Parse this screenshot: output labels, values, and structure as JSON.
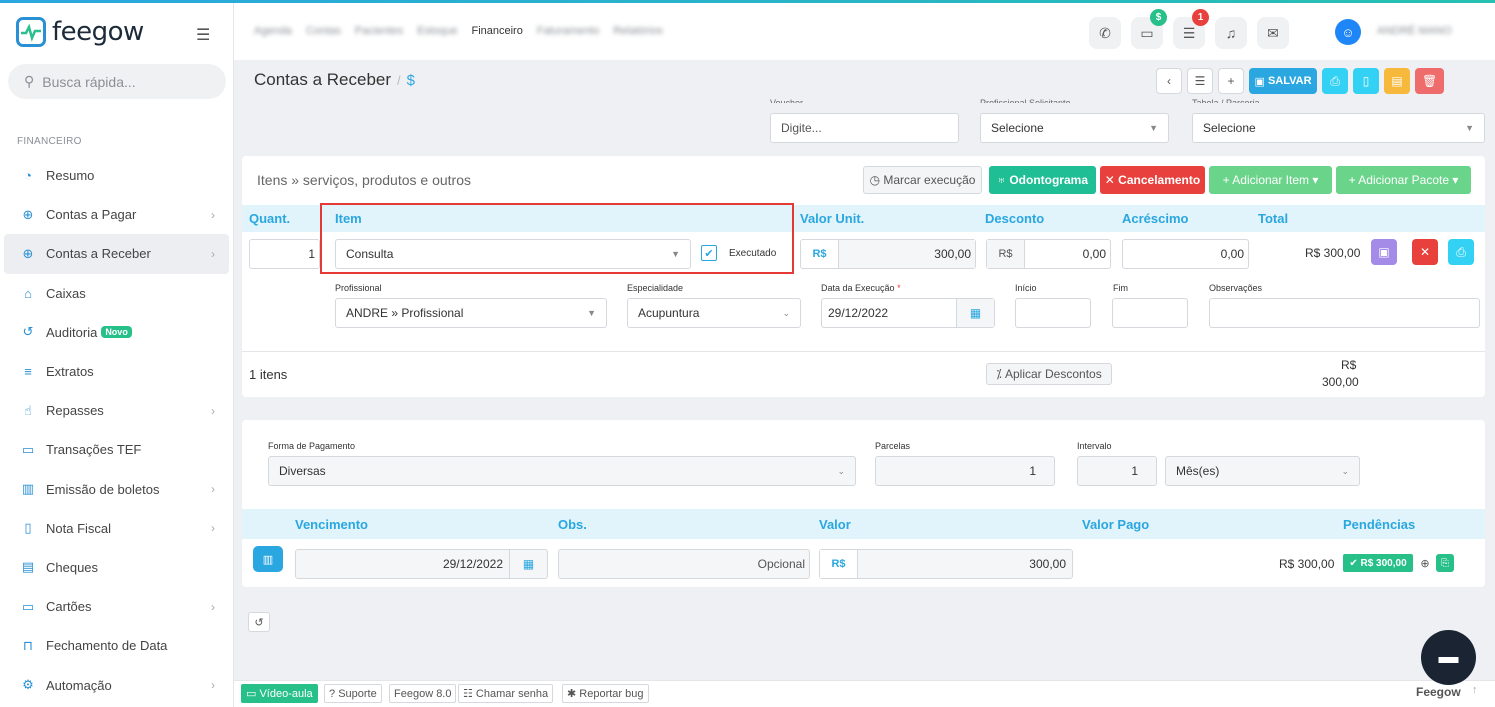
{
  "sidebar": {
    "logo": "feegow",
    "search_placeholder": "Busca rápida...",
    "section": "FINANCEIRO",
    "items": [
      {
        "label": "Resumo",
        "icon": "pie-chart-icon",
        "chev": false
      },
      {
        "label": "Contas a Pagar",
        "icon": "arrow-up-circle-icon",
        "chev": true
      },
      {
        "label": "Contas a Receber",
        "icon": "arrow-down-circle-icon",
        "chev": true,
        "active": true
      },
      {
        "label": "Caixas",
        "icon": "inbox-icon",
        "chev": false
      },
      {
        "label": "Auditoria",
        "icon": "history-icon",
        "chev": false,
        "badge": "Novo"
      },
      {
        "label": "Extratos",
        "icon": "list-icon",
        "chev": false
      },
      {
        "label": "Repasses",
        "icon": "hand-icon",
        "chev": true
      },
      {
        "label": "Transações TEF",
        "icon": "card-icon",
        "chev": false
      },
      {
        "label": "Emissão de boletos",
        "icon": "barcode-icon",
        "chev": true
      },
      {
        "label": "Nota Fiscal",
        "icon": "document-icon",
        "chev": true
      },
      {
        "label": "Cheques",
        "icon": "check-doc-icon",
        "chev": false
      },
      {
        "label": "Cartões",
        "icon": "credit-card-icon",
        "chev": true
      },
      {
        "label": "Fechamento de Data",
        "icon": "lock-icon",
        "chev": false
      },
      {
        "label": "Automação",
        "icon": "gears-icon",
        "chev": true
      }
    ]
  },
  "topnav": {
    "links": [
      "Agenda",
      "Contas",
      "Pacientes",
      "Estoque",
      "Financeiro",
      "Faturamento",
      "Relatórios"
    ],
    "active": "Financeiro",
    "badges": {
      "money": "$",
      "tasks": "1"
    },
    "user": "ANDRÉ MANO"
  },
  "header": {
    "title": "Contas a Receber",
    "sep": "/",
    "current": "$",
    "save": "SALVAR"
  },
  "top_fields": {
    "voucher_label": "Voucher",
    "voucher_placeholder": "Digite...",
    "solicitante_label": "Profissional Solicitante",
    "solicitante_value": "Selecione",
    "tabela_label": "Tabela / Parceria",
    "tabela_value": "Selecione"
  },
  "items": {
    "title": "Itens » serviços, produtos e outros",
    "buttons": {
      "marcar": "Marcar execução",
      "odonto": "Odontograma",
      "cancel": "Cancelamento",
      "add_item": "+ Adicionar Item",
      "add_pacote": "+ Adicionar Pacote"
    },
    "headers": {
      "quant": "Quant.",
      "item": "Item",
      "valor": "Valor Unit.",
      "desconto": "Desconto",
      "acrescimo": "Acréscimo",
      "total": "Total"
    },
    "row": {
      "quant": "1",
      "item": "Consulta",
      "executado": "Executado",
      "currency": "R$",
      "valor": "300,00",
      "desconto": "0,00",
      "acrescimo": "0,00",
      "total": "R$ 300,00"
    },
    "details": {
      "profissional_label": "Profissional",
      "profissional": "ANDRE » Profissional",
      "especialidade_label": "Especialidade",
      "especialidade": "Acupuntura",
      "data_label": "Data da Execução",
      "data": "29/12/2022",
      "inicio_label": "Início",
      "fim_label": "Fim",
      "obs_label": "Observações"
    },
    "count": "1 itens",
    "aplicar": "Aplicar Descontos",
    "sum_currency": "R$",
    "sum_value": "300,00"
  },
  "payment": {
    "forma_label": "Forma de Pagamento",
    "forma": "Diversas",
    "parcelas_label": "Parcelas",
    "parcelas": "1",
    "intervalo_label": "Intervalo",
    "intervalo": "1",
    "periodo": "Mês(es)",
    "headers": {
      "venc": "Vencimento",
      "obs": "Obs.",
      "valor": "Valor",
      "pago": "Valor Pago",
      "pend": "Pendências"
    },
    "row": {
      "venc": "29/12/2022",
      "obs_placeholder": "Opcional",
      "currency": "R$",
      "valor": "300,00",
      "pend_total": "R$ 300,00",
      "pend_badge": "R$ 300,00"
    }
  },
  "footer": {
    "video": "Vídeo-aula",
    "suporte": "Suporte",
    "versao": "Feegow 8.0",
    "senha": "Chamar senha",
    "bug": "Reportar bug",
    "brand": "Feegow"
  }
}
